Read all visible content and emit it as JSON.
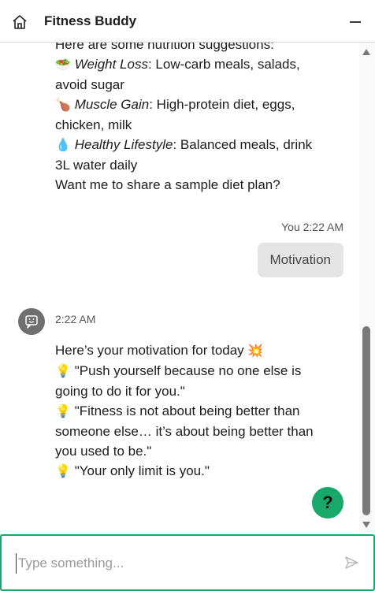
{
  "header": {
    "icon": "home-icon",
    "title": "Fitness Buddy",
    "minimize_icon": "minimize-icon"
  },
  "messages": {
    "nutrition": {
      "intro": "Here are some nutrition suggestions:",
      "items": [
        {
          "emoji": "🥗",
          "label": "Weight Loss",
          "text": ": Low-carb meals, salads,",
          "cont": "avoid sugar"
        },
        {
          "emoji": "🍗",
          "label": "Muscle Gain",
          "text": ": High-protein diet, eggs,",
          "cont": "chicken, milk"
        },
        {
          "emoji": "💧",
          "label": "Healthy Lifestyle",
          "text": ": Balanced meals, drink",
          "cont": "3L water daily"
        }
      ],
      "closing": "Want me to share a sample diet plan?"
    },
    "user": {
      "meta": "You 2:22 AM",
      "text": "Motivation"
    },
    "bot": {
      "avatar_icon": "chat-bot-icon",
      "time": "2:22 AM",
      "intro": "Here’s your motivation for today",
      "intro_emoji": "💥",
      "quotes": [
        {
          "emoji": "💡",
          "line1": "\"Push yourself because no one else is",
          "line2": "going to do it for you.\""
        },
        {
          "emoji": "💡",
          "line1": "\"Fitness is not about being better than",
          "line2": "someone else… it’s about being better than",
          "line3": "you used to be.\""
        },
        {
          "emoji": "💡",
          "line1": "\"Your only limit is you.\""
        }
      ]
    }
  },
  "help_button": {
    "label": "?"
  },
  "input": {
    "placeholder": "Type something...",
    "value": "",
    "send_icon": "send-icon"
  },
  "colors": {
    "accent": "#17a86a",
    "avatar": "#6f6f6f",
    "user_bubble": "#e5e5e5"
  }
}
